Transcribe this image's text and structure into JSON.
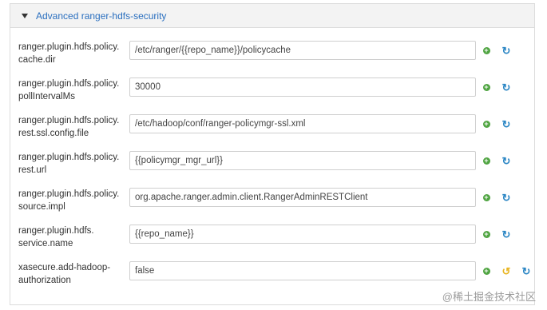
{
  "section": {
    "title": "Advanced ranger-hdfs-security"
  },
  "rows": [
    {
      "label_line1": "ranger.plugin.hdfs.policy.",
      "label_line2": "cache.dir",
      "value": "/etc/ranger/{{repo_name}}/policycache"
    },
    {
      "label_line1": "ranger.plugin.hdfs.policy.",
      "label_line2": "pollIntervalMs",
      "value": "30000"
    },
    {
      "label_line1": "ranger.plugin.hdfs.policy.",
      "label_line2": "rest.ssl.config.file",
      "value": "/etc/hadoop/conf/ranger-policymgr-ssl.xml"
    },
    {
      "label_line1": "ranger.plugin.hdfs.policy.",
      "label_line2": "rest.url",
      "value": "{{policymgr_mgr_url}}"
    },
    {
      "label_line1": "ranger.plugin.hdfs.policy.",
      "label_line2": "source.impl",
      "value": "org.apache.ranger.admin.client.RangerAdminRESTClient"
    },
    {
      "label_line1": "ranger.plugin.hdfs.",
      "label_line2": "service.name",
      "value": "{{repo_name}}"
    },
    {
      "label_line1": "xasecure.add-hadoop-",
      "label_line2": "authorization",
      "value": "false"
    }
  ],
  "icons": {
    "add": "+",
    "refresh": "↻",
    "undo": "↺"
  },
  "colors": {
    "title": "#2a6fbf",
    "add": "#4fa441",
    "refresh": "#2b86c4",
    "undo": "#e8b521"
  },
  "watermark": "@稀土掘金技术社区"
}
